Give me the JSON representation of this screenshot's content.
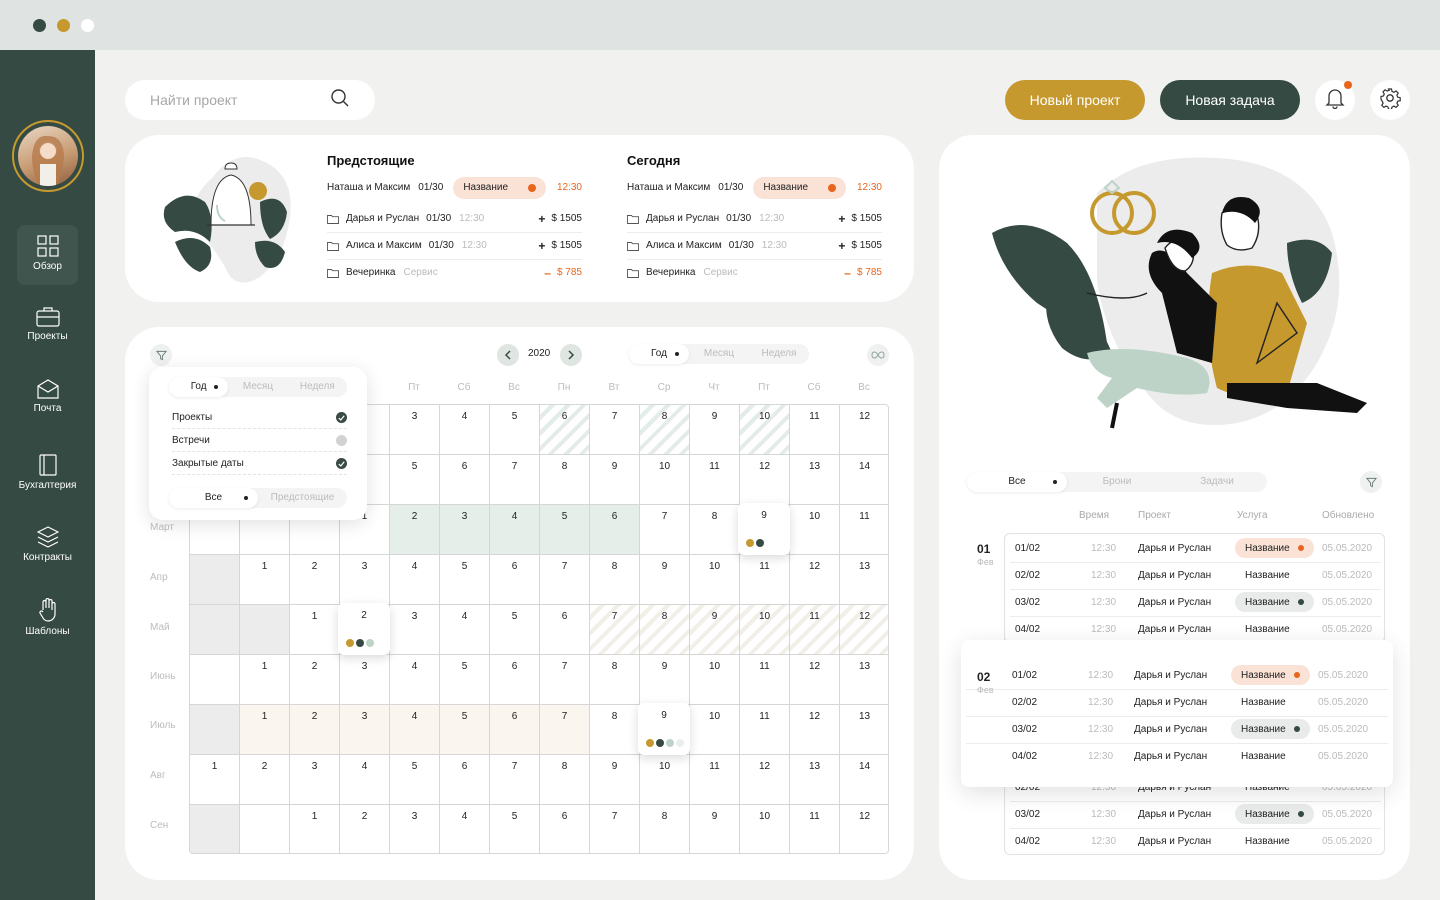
{
  "colors": {
    "dark_green": "#354a43",
    "gold": "#c6992e",
    "orange": "#e8651e",
    "bg": "#f1f1ef"
  },
  "search": {
    "placeholder": "Найти проект"
  },
  "header": {
    "new_project": "Новый проект",
    "new_task": "Новая задача"
  },
  "nav": [
    {
      "label": "Обзор",
      "icon": "grid-icon"
    },
    {
      "label": "Проекты",
      "icon": "briefcase-icon"
    },
    {
      "label": "Почта",
      "icon": "mail-icon"
    },
    {
      "label": "Бухгалтерия",
      "icon": "book-icon"
    },
    {
      "label": "Контракты",
      "icon": "layers-icon"
    },
    {
      "label": "Шаблоны",
      "icon": "hand-icon"
    }
  ],
  "upcoming": {
    "title": "Предстоящие",
    "main": {
      "name": "Наташа и Максим",
      "date": "01/30",
      "pill": "Название",
      "time": "12:30"
    },
    "rows": [
      {
        "name": "Дарья и Руслан",
        "date": "01/30",
        "time": "12:30",
        "sign": "+",
        "amount": "$ 1505"
      },
      {
        "name": "Алиса и Максим",
        "date": "01/30",
        "time": "12:30",
        "sign": "+",
        "amount": "$ 1505"
      },
      {
        "name": "Вечеринка",
        "sub": "Сервис",
        "sign": "–",
        "amount": "$ 785"
      }
    ]
  },
  "today": {
    "title": "Сегодня",
    "main": {
      "name": "Наташа и Максим",
      "date": "01/30",
      "pill": "Название",
      "time": "12:30"
    },
    "rows": [
      {
        "name": "Дарья и Руслан",
        "date": "01/30",
        "time": "12:30",
        "sign": "+",
        "amount": "$ 1505"
      },
      {
        "name": "Алиса и Максим",
        "date": "01/30",
        "time": "12:30",
        "sign": "+",
        "amount": "$ 1505"
      },
      {
        "name": "Вечеринка",
        "sub": "Сервис",
        "sign": "–",
        "amount": "$ 785"
      }
    ]
  },
  "calendar": {
    "year": "2020",
    "view_tabs": [
      "Год",
      "Месяц",
      "Неделя"
    ],
    "days": [
      "Пт",
      "Сб",
      "Вс",
      "Пн",
      "Вт",
      "Ср",
      "Чт",
      "Пт",
      "Сб",
      "Вс"
    ],
    "months": [
      "Март",
      "Апр",
      "Май",
      "Июнь",
      "Июль",
      "Авг",
      "Сен"
    ],
    "rows": [
      [
        "",
        "",
        "",
        "3",
        "4",
        "5",
        "6",
        "7",
        "8",
        "9",
        "10",
        "11",
        "12"
      ],
      [
        "",
        "",
        "",
        "5",
        "6",
        "7",
        "8",
        "9",
        "10",
        "11",
        "12",
        "13",
        "14"
      ],
      [
        "",
        "",
        "",
        "1",
        "2",
        "3",
        "4",
        "5",
        "6",
        "7",
        "8",
        "9",
        "10",
        "11"
      ],
      [
        "",
        "1",
        "2",
        "3",
        "4",
        "5",
        "6",
        "7",
        "8",
        "9",
        "10",
        "11",
        "12",
        "13"
      ],
      [
        "",
        "",
        "1",
        "2",
        "3",
        "4",
        "5",
        "6",
        "7",
        "8",
        "9",
        "10",
        "11",
        "12"
      ],
      [
        "",
        "1",
        "2",
        "3",
        "4",
        "5",
        "6",
        "7",
        "8",
        "9",
        "10",
        "11",
        "12",
        "13"
      ],
      [
        "",
        "1",
        "2",
        "3",
        "4",
        "5",
        "6",
        "7",
        "8",
        "9",
        "10",
        "11",
        "12",
        "13"
      ],
      [
        "1",
        "2",
        "3",
        "4",
        "5",
        "6",
        "7",
        "8",
        "9",
        "10",
        "11",
        "12",
        "13",
        "14"
      ],
      [
        "",
        "",
        "1",
        "2",
        "3",
        "4",
        "5",
        "6",
        "7",
        "8",
        "9",
        "10",
        "11",
        "12"
      ]
    ],
    "popup": {
      "tabs": [
        "Год",
        "Месяц",
        "Неделя"
      ],
      "items": [
        {
          "label": "Проекты",
          "checked": true
        },
        {
          "label": "Встречи",
          "checked": false
        },
        {
          "label": "Закрытые даты",
          "checked": true
        }
      ],
      "bottom_tabs": [
        "Все",
        "Предстоящие"
      ]
    },
    "tips": [
      {
        "day": "9"
      },
      {
        "day": "2"
      },
      {
        "day": "9"
      }
    ]
  },
  "bookings": {
    "tabs": [
      "Все",
      "Брони",
      "Задачи"
    ],
    "headers": [
      "Время",
      "Проект",
      "Услуга",
      "Обновлено"
    ],
    "groups": [
      {
        "day": "01",
        "month": "Фев",
        "rows": [
          {
            "date": "01/02",
            "time": "12:30",
            "project": "Дарья и Руслан",
            "service": "Название",
            "tag": "orange",
            "updated": "05.05.2020"
          },
          {
            "date": "02/02",
            "time": "12:30",
            "project": "Дарья и Руслан",
            "service": "Название",
            "tag": "",
            "updated": "05.05.2020"
          },
          {
            "date": "03/02",
            "time": "12:30",
            "project": "Дарья и Руслан",
            "service": "Название",
            "tag": "dark",
            "updated": "05.05.2020"
          },
          {
            "date": "04/02",
            "time": "12:30",
            "project": "Дарья и Руслан",
            "service": "Название",
            "tag": "",
            "updated": "05.05.2020"
          }
        ]
      },
      {
        "day": "02",
        "month": "Фев",
        "rows": [
          {
            "date": "01/02",
            "time": "12:30",
            "project": "Дарья и Руслан",
            "service": "Название",
            "tag": "orange",
            "updated": "05.05.2020"
          },
          {
            "date": "02/02",
            "time": "12:30",
            "project": "Дарья и Руслан",
            "service": "Название",
            "tag": "",
            "updated": "05.05.2020"
          },
          {
            "date": "03/02",
            "time": "12:30",
            "project": "Дарья и Руслан",
            "service": "Название",
            "tag": "dark",
            "updated": "05.05.2020"
          },
          {
            "date": "04/02",
            "time": "12:30",
            "project": "Дарья и Руслан",
            "service": "Название",
            "tag": "",
            "updated": "05.05.2020"
          }
        ]
      },
      {
        "day": "",
        "month": "",
        "rows": [
          {
            "date": "02/02",
            "time": "12:30",
            "project": "Дарья и Руслан",
            "service": "Название",
            "tag": "",
            "updated": "05.05.2020"
          },
          {
            "date": "03/02",
            "time": "12:30",
            "project": "Дарья и Руслан",
            "service": "Название",
            "tag": "dark",
            "updated": "05.05.2020"
          },
          {
            "date": "04/02",
            "time": "12:30",
            "project": "Дарья и Руслан",
            "service": "Название",
            "tag": "",
            "updated": "05.05.2020"
          }
        ]
      }
    ]
  }
}
